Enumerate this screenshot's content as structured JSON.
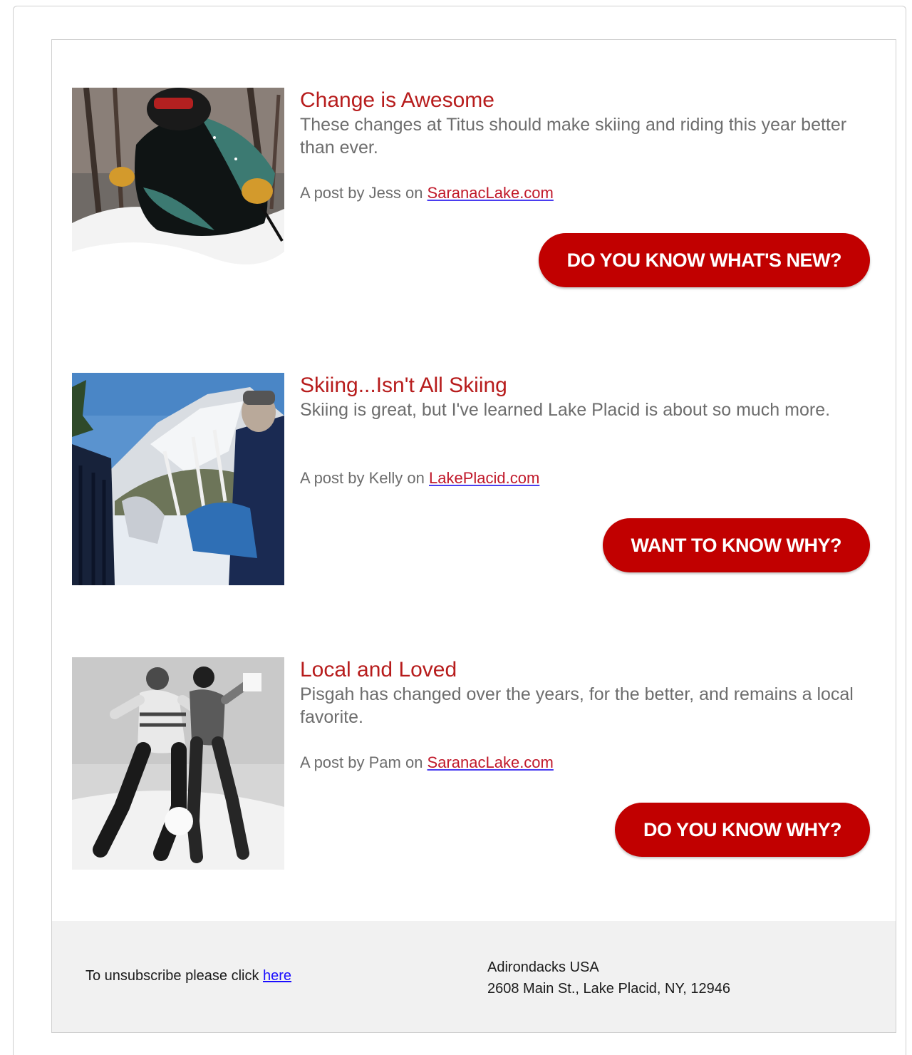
{
  "articles": [
    {
      "title": "Change is Awesome",
      "description": "These changes at Titus should make skiing and riding this year better than ever.",
      "byline_prefix": "A post by Jess on ",
      "site_link": "SaranacLake.com",
      "cta": "DO YOU KNOW WHAT'S NEW?",
      "image": "skier-in-powder-photo"
    },
    {
      "title": "Skiing...Isn't All Skiing",
      "description": "Skiing is great, but I've learned Lake Placid is about so much more.",
      "byline_prefix": "A post by Kelly on ",
      "site_link": "LakePlacid.com",
      "cta": "WANT TO KNOW WHY?",
      "image": "mountain-view-chairs-photo"
    },
    {
      "title": "Local and Loved",
      "description": "Pisgah has changed over the years, for the better, and remains a local favorite.",
      "byline_prefix": "A post by Pam on ",
      "site_link": "SaranacLake.com",
      "cta": "DO YOU KNOW WHY?",
      "image": "vintage-couple-snowball-photo"
    }
  ],
  "footer": {
    "unsubscribe_text": "To unsubscribe please click ",
    "unsubscribe_link": "here",
    "org_name": "Adirondacks USA",
    "address": "2608 Main St., Lake Placid, NY, 12946"
  },
  "colors": {
    "accent": "#c10000",
    "title": "#b71c1c",
    "body_text": "#6d6d6d",
    "footer_bg": "#f1f1f1"
  }
}
